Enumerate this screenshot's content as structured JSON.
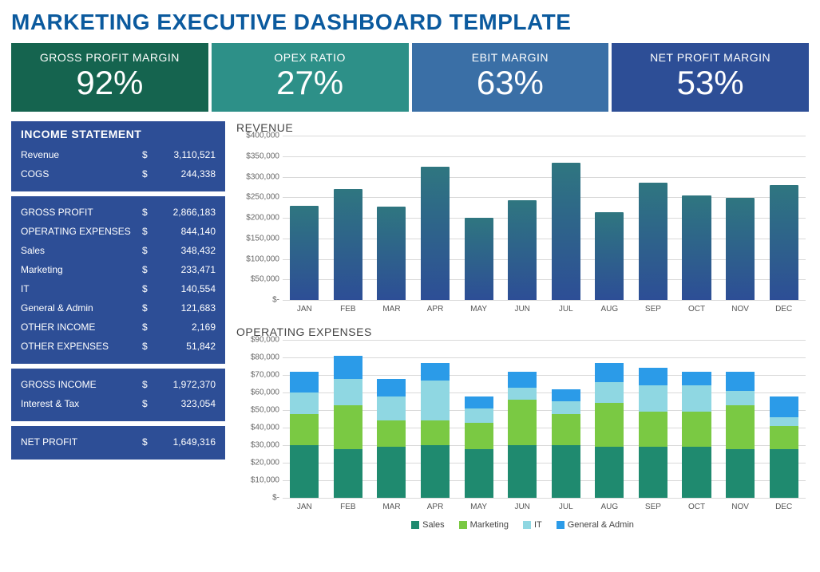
{
  "title": "MARKETING EXECUTIVE DASHBOARD TEMPLATE",
  "kpis": [
    {
      "label": "GROSS PROFIT MARGIN",
      "value": "92%"
    },
    {
      "label": "OPEX RATIO",
      "value": "27%"
    },
    {
      "label": "EBIT MARGIN",
      "value": "63%"
    },
    {
      "label": "NET PROFIT MARGIN",
      "value": "53%"
    }
  ],
  "income": {
    "header": "INCOME STATEMENT",
    "currency": "$",
    "block1": [
      {
        "label": "Revenue",
        "value": "3,110,521"
      },
      {
        "label": "COGS",
        "value": "244,338"
      }
    ],
    "block2": [
      {
        "label": "GROSS PROFIT",
        "value": "2,866,183"
      },
      {
        "label": "OPERATING EXPENSES",
        "value": "844,140"
      },
      {
        "label": "Sales",
        "value": "348,432"
      },
      {
        "label": "Marketing",
        "value": "233,471"
      },
      {
        "label": "IT",
        "value": "140,554"
      },
      {
        "label": "General & Admin",
        "value": "121,683"
      },
      {
        "label": "OTHER INCOME",
        "value": "2,169"
      },
      {
        "label": "OTHER EXPENSES",
        "value": "51,842"
      }
    ],
    "block3": [
      {
        "label": "GROSS INCOME",
        "value": "1,972,370"
      },
      {
        "label": "Interest & Tax",
        "value": "323,054"
      }
    ],
    "block4": [
      {
        "label": "NET PROFIT",
        "value": "1,649,316"
      }
    ]
  },
  "revenue_chart_title": "REVENUE",
  "opex_chart_title": "OPERATING EXPENSES",
  "chart_data": [
    {
      "type": "bar",
      "title": "REVENUE",
      "xlabel": "",
      "ylabel": "",
      "ylim": [
        0,
        400000
      ],
      "y_ticks": [
        "$-",
        "$50,000",
        "$100,000",
        "$150,000",
        "$200,000",
        "$250,000",
        "$300,000",
        "$350,000",
        "$400,000"
      ],
      "categories": [
        "JAN",
        "FEB",
        "MAR",
        "APR",
        "MAY",
        "JUN",
        "JUL",
        "AUG",
        "SEP",
        "OCT",
        "NOV",
        "DEC"
      ],
      "values": [
        230000,
        270000,
        228000,
        325000,
        200000,
        243000,
        335000,
        214000,
        285000,
        255000,
        248000,
        280000
      ]
    },
    {
      "type": "bar",
      "stacked": true,
      "title": "OPERATING EXPENSES",
      "xlabel": "",
      "ylabel": "",
      "ylim": [
        0,
        90000
      ],
      "y_ticks": [
        "$-",
        "$10,000",
        "$20,000",
        "$30,000",
        "$40,000",
        "$50,000",
        "$60,000",
        "$70,000",
        "$80,000",
        "$90,000"
      ],
      "categories": [
        "JAN",
        "FEB",
        "MAR",
        "APR",
        "MAY",
        "JUN",
        "JUL",
        "AUG",
        "SEP",
        "OCT",
        "NOV",
        "DEC"
      ],
      "legend_position": "bottom",
      "series": [
        {
          "name": "Sales",
          "color": "#1f8a6f",
          "values": [
            30000,
            28000,
            29000,
            30000,
            28000,
            30000,
            30000,
            29000,
            29000,
            29000,
            28000,
            28000
          ]
        },
        {
          "name": "Marketing",
          "color": "#7ac943",
          "values": [
            18000,
            25000,
            15000,
            14000,
            15000,
            26000,
            18000,
            25000,
            20000,
            20000,
            25000,
            13000
          ]
        },
        {
          "name": "IT",
          "color": "#8fd7e2",
          "values": [
            12000,
            15000,
            14000,
            23000,
            8000,
            7000,
            7000,
            12000,
            15000,
            15000,
            8000,
            5000
          ]
        },
        {
          "name": "General & Admin",
          "color": "#2b9be8",
          "values": [
            12000,
            13000,
            10000,
            10000,
            7000,
            9000,
            7000,
            11000,
            10000,
            8000,
            11000,
            12000
          ]
        }
      ]
    }
  ]
}
